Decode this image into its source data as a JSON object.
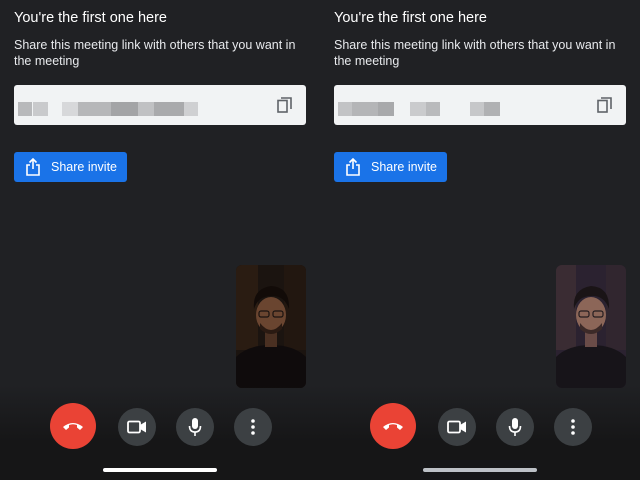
{
  "screens": [
    {
      "heading": "You're the first one here",
      "subtitle": "Share this meeting link with others that you want in the meeting",
      "meeting_link_value": "",
      "share_button_label": "Share invite",
      "icons": [
        "copy-icon",
        "share-icon",
        "end-call-icon",
        "camera-icon",
        "microphone-icon",
        "more-options-icon"
      ]
    },
    {
      "heading": "You're the first one here",
      "subtitle": "Share this meeting link with others that you want in the meeting",
      "meeting_link_value": "",
      "share_button_label": "Share invite",
      "icons": [
        "copy-icon",
        "share-icon",
        "end-call-icon",
        "camera-icon",
        "microphone-icon",
        "more-options-icon"
      ]
    }
  ],
  "colors": {
    "background": "#202124",
    "accent_blue": "#1a73e8",
    "end_call_red": "#ea4335",
    "control_grey": "#3c4043"
  }
}
